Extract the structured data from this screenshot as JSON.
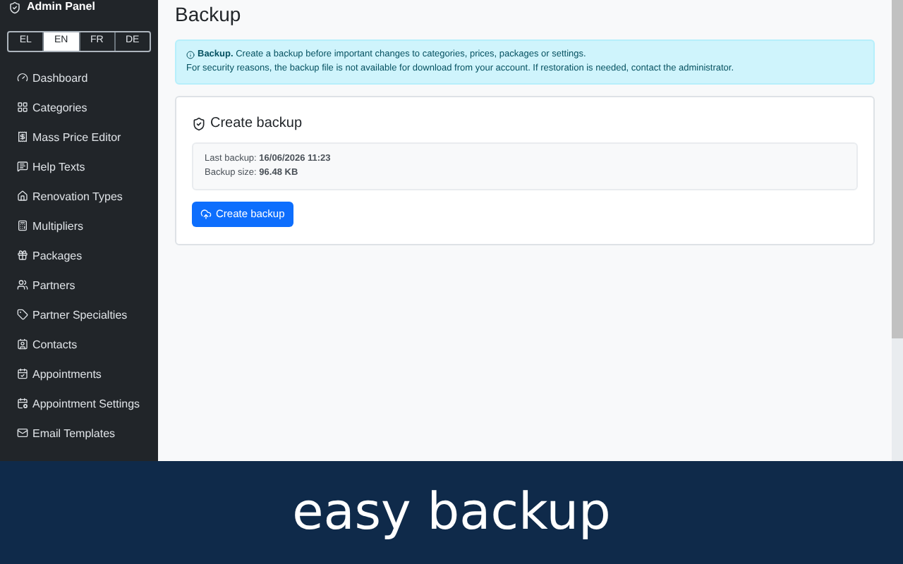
{
  "sidebar": {
    "brand": "Admin Panel",
    "languages": [
      {
        "label": "EL",
        "selected": false
      },
      {
        "label": "EN",
        "selected": true
      },
      {
        "label": "FR",
        "selected": false
      },
      {
        "label": "DE",
        "selected": false
      }
    ],
    "items": [
      {
        "label": "Dashboard",
        "kind": "dashboard"
      },
      {
        "label": "Categories",
        "kind": "grid"
      },
      {
        "label": "Mass Price Editor",
        "kind": "price"
      },
      {
        "label": "Help Texts",
        "kind": "help"
      },
      {
        "label": "Renovation Types",
        "kind": "house"
      },
      {
        "label": "Multipliers",
        "kind": "calc"
      },
      {
        "label": "Packages",
        "kind": "gift"
      },
      {
        "label": "Partners",
        "kind": "people"
      },
      {
        "label": "Partner Specialties",
        "kind": "tag"
      },
      {
        "label": "Contacts",
        "kind": "contact"
      },
      {
        "label": "Appointments",
        "kind": "calendar"
      },
      {
        "label": "Appointment Settings",
        "kind": "calendar-settings"
      },
      {
        "label": "Email Templates",
        "kind": "mail"
      }
    ]
  },
  "page": {
    "title": "Backup",
    "alert": {
      "lines": [
        "**Backup.** Create a backup before important changes to categories, prices, packages or settings.",
        "For security reasons, the backup file is not available for download from your account. If restoration is needed, contact the administrator."
      ]
    },
    "card": {
      "title": "Create backup",
      "info": [
        "Last backup: **16/06/2026 11:23**",
        "Backup size: **96.48 KB**"
      ],
      "button": "Create backup"
    }
  },
  "caption": "easy backup"
}
